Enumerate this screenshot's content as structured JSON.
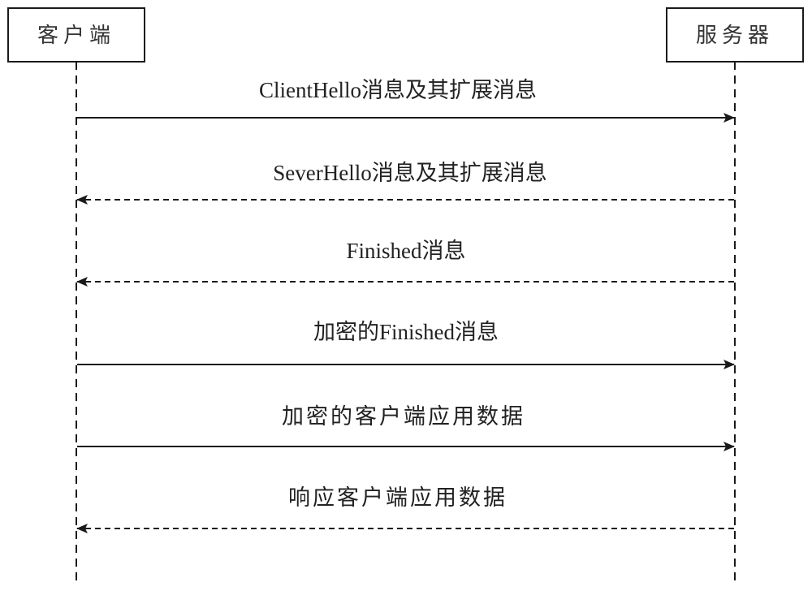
{
  "diagram": {
    "type": "sequence",
    "participants": [
      {
        "id": "client",
        "label": "客户端"
      },
      {
        "id": "server",
        "label": "服务器"
      }
    ],
    "messages": [
      {
        "from": "client",
        "to": "server",
        "label": "ClientHello消息及其扩展消息",
        "style": "solid"
      },
      {
        "from": "server",
        "to": "client",
        "label": "SeverHello消息及其扩展消息",
        "style": "dashed"
      },
      {
        "from": "server",
        "to": "client",
        "label": "Finished消息",
        "style": "dashed"
      },
      {
        "from": "client",
        "to": "server",
        "label": "加密的Finished消息",
        "style": "solid"
      },
      {
        "from": "client",
        "to": "server",
        "label": "加密的客户端应用数据",
        "style": "solid"
      },
      {
        "from": "server",
        "to": "client",
        "label": "响应客户端应用数据",
        "style": "dashed"
      }
    ],
    "colors": {
      "line": "#1a1a1a",
      "text": "#222222",
      "actor_text": "#333333",
      "box_border": "#1a1a1a"
    }
  }
}
